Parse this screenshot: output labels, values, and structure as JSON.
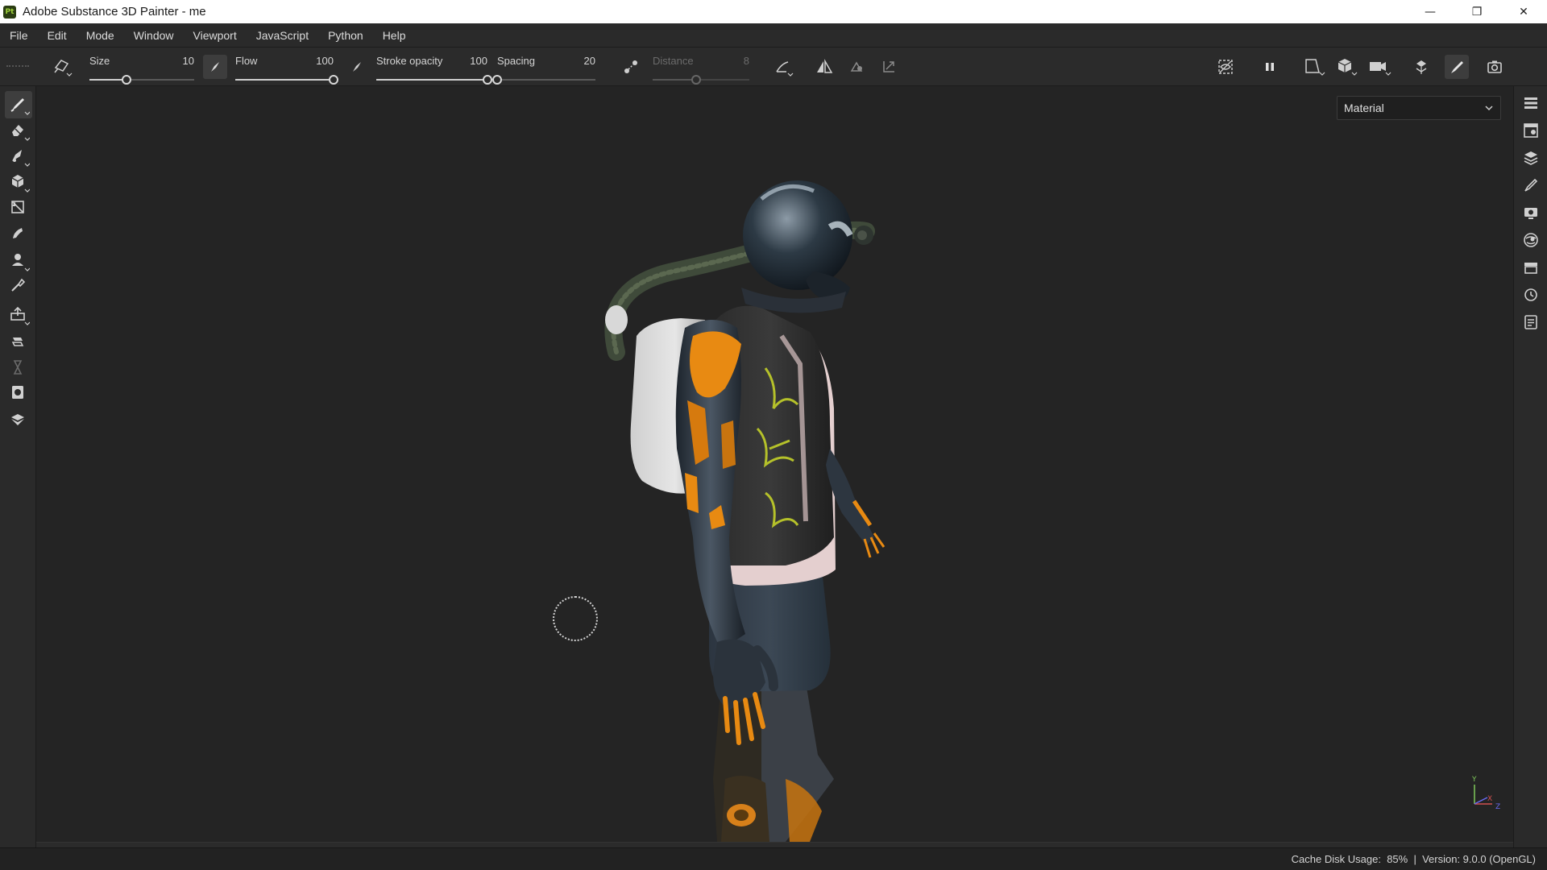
{
  "window": {
    "logo_text": "Pt",
    "title": "Adobe Substance 3D Painter - me",
    "minimize_glyph": "—",
    "restore_glyph": "❐",
    "close_glyph": "✕"
  },
  "menu": [
    "File",
    "Edit",
    "Mode",
    "Window",
    "Viewport",
    "JavaScript",
    "Python",
    "Help"
  ],
  "tool_options": {
    "size": {
      "label": "Size",
      "value": "10",
      "level": 0.35
    },
    "flow": {
      "label": "Flow",
      "value": "100",
      "level": 1.0
    },
    "stroke_opacity": {
      "label": "Stroke opacity",
      "value": "100",
      "level": 1.0
    },
    "spacing": {
      "label": "Spacing",
      "value": "20",
      "level": 0.0
    },
    "distance": {
      "label": "Distance",
      "value": "8",
      "level": 0.45,
      "disabled": true
    }
  },
  "left_tools": [
    "paint-brush",
    "eraser",
    "projection",
    "polygon-fill",
    "smudge",
    "clone",
    "color-picker",
    "bake",
    "quick-mask",
    "geometry-mask",
    "baking",
    "export",
    "display"
  ],
  "viewport": {
    "display_mode": "Material",
    "axis_labels": {
      "y": "Y",
      "x": "X",
      "z": "Z"
    }
  },
  "status": {
    "cache_label": "Cache Disk Usage:",
    "cache_value": "85%",
    "separator": "|",
    "version": "Version: 9.0.0 (OpenGL)"
  },
  "colors": {
    "accent_orange": "#e88a12",
    "bg_dark": "#242424",
    "panel": "#2a2a2a"
  }
}
